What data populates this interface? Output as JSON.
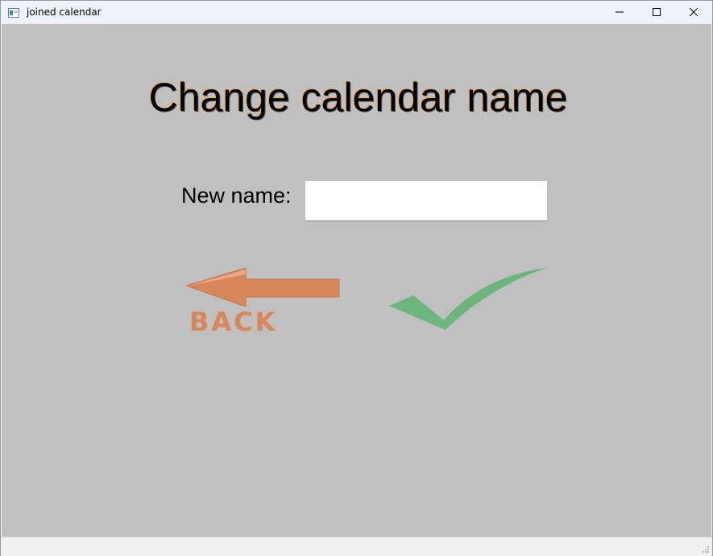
{
  "window": {
    "title": "joined calendar",
    "icon": "app-window-icon",
    "controls": [
      "minimize-icon",
      "maximize-icon",
      "close-icon"
    ]
  },
  "main": {
    "heading": "Change calendar name",
    "new_name_label": "New name:",
    "new_name_value": "",
    "back_button_text": "BACK",
    "back_icon": "back-arrow-icon",
    "confirm_icon": "checkmark-icon"
  },
  "colors": {
    "background": "#c0c0c0",
    "back_orange": "#d8875a",
    "confirm_green": "#6cb57c",
    "titlebar": "#eef3fb"
  }
}
